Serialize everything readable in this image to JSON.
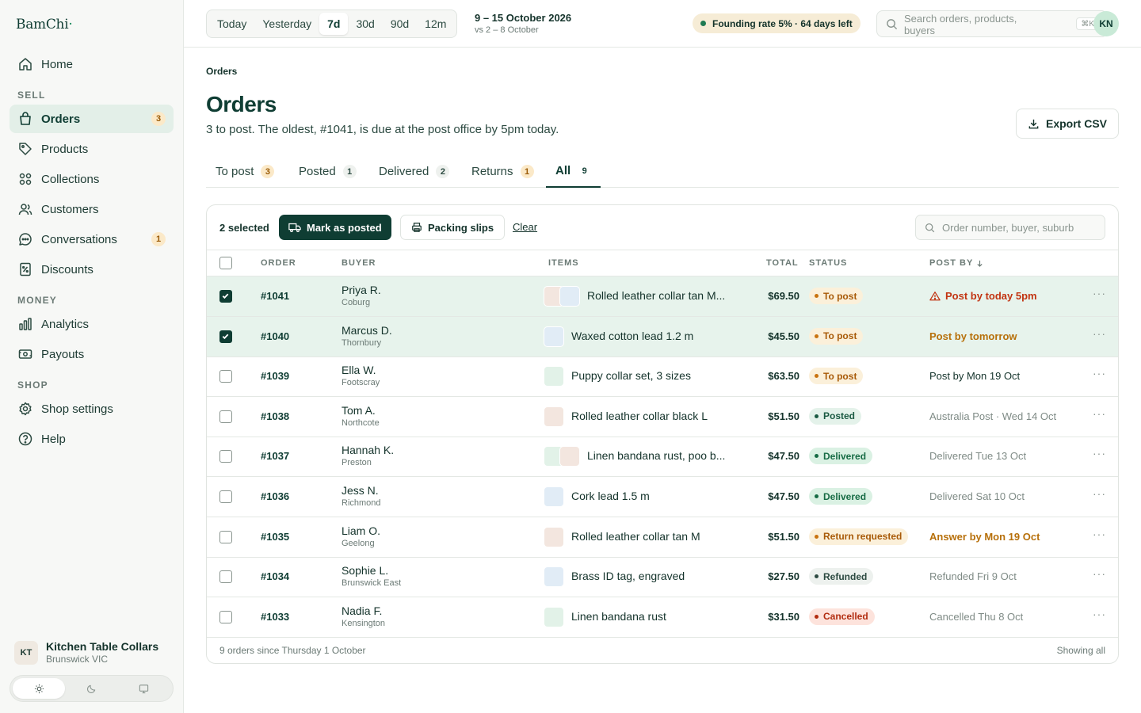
{
  "app": {
    "logo": "BamChi",
    "logo_mark": "·"
  },
  "sidebar": {
    "sections": {
      "sell": "SELL",
      "money": "MONEY",
      "shop": "SHOP"
    },
    "items": [
      {
        "label": "Home",
        "icon": "home-icon"
      },
      {
        "label": "Orders",
        "icon": "bag-icon",
        "count": "3",
        "active": true
      },
      {
        "label": "Products",
        "icon": "tag-icon"
      },
      {
        "label": "Collections",
        "icon": "grid-icon"
      },
      {
        "label": "Customers",
        "icon": "users-icon"
      },
      {
        "label": "Conversations",
        "icon": "chat-icon",
        "count": "1"
      },
      {
        "label": "Discounts",
        "icon": "discount-icon"
      },
      {
        "label": "Analytics",
        "icon": "bar-chart-icon"
      },
      {
        "label": "Payouts",
        "icon": "payout-icon"
      },
      {
        "label": "Shop settings",
        "icon": "gear-icon"
      },
      {
        "label": "Help",
        "icon": "help-icon"
      }
    ],
    "shop": {
      "initials": "KT",
      "name": "Kitchen Table Collars",
      "location": "Brunswick VIC"
    },
    "theme": {
      "options": [
        "light",
        "dark",
        "system"
      ],
      "selected": "light"
    }
  },
  "topbar": {
    "ranges": [
      "Today",
      "Yesterday",
      "7d",
      "30d",
      "90d",
      "12m"
    ],
    "selected_range": "7d",
    "date_main": "9 – 15 October 2026",
    "date_compare": "vs 2 – 8 October",
    "rate_pill": "Founding rate 5% · 64 days left",
    "search_placeholder": "Search orders, products, buyers",
    "search_shortcut": "⌘K",
    "user_initials": "KN"
  },
  "page": {
    "breadcrumb": "Orders",
    "title": "Orders",
    "subtitle": "3 to post. The oldest, #1041, is due at the post office by 5pm today.",
    "export_label": "Export CSV"
  },
  "tabs": [
    {
      "label": "To post",
      "count": "3"
    },
    {
      "label": "Posted",
      "count": "1"
    },
    {
      "label": "Delivered",
      "count": "2"
    },
    {
      "label": "Returns",
      "count": "1"
    },
    {
      "label": "All",
      "count": "9",
      "active": true
    }
  ],
  "bulk": {
    "selected_label": "2 selected",
    "mark_posted": "Mark as posted",
    "packing_slips": "Packing slips",
    "clear": "Clear",
    "search_placeholder": "Order number, buyer, suburb"
  },
  "table": {
    "columns": {
      "order": "ORDER",
      "buyer": "BUYER",
      "items": "ITEMS",
      "total": "TOTAL",
      "status": "STATUS",
      "post_by": "POST BY"
    },
    "rows": [
      {
        "selected": true,
        "order": "#1041",
        "buyer": "Priya R.",
        "suburb": "Coburg",
        "item": "Rolled leather collar tan M...",
        "thumbs": [
          "#f3e6df",
          "#e1ecf6"
        ],
        "total": "$69.50",
        "status": "To post",
        "status_kind": "topost",
        "post_by": "Post by today 5pm",
        "post_kind": "urgent"
      },
      {
        "selected": true,
        "order": "#1040",
        "buyer": "Marcus D.",
        "suburb": "Thornbury",
        "item": "Waxed cotton lead 1.2 m",
        "thumbs": [
          "#e1ecf6"
        ],
        "total": "$45.50",
        "status": "To post",
        "status_kind": "topost",
        "post_by": "Post by tomorrow",
        "post_kind": "warn"
      },
      {
        "selected": false,
        "order": "#1039",
        "buyer": "Ella W.",
        "suburb": "Footscray",
        "item": "Puppy collar set, 3 sizes",
        "thumbs": [
          "#e2f2e8"
        ],
        "total": "$63.50",
        "status": "To post",
        "status_kind": "topost",
        "post_by": "Post by Mon 19 Oct",
        "post_kind": "normal"
      },
      {
        "selected": false,
        "order": "#1038",
        "buyer": "Tom A.",
        "suburb": "Northcote",
        "item": "Rolled leather collar black L",
        "thumbs": [
          "#f3e6df"
        ],
        "total": "$51.50",
        "status": "Posted",
        "status_kind": "posted",
        "post_by": "Australia Post · Wed 14 Oct",
        "post_kind": "muted"
      },
      {
        "selected": false,
        "order": "#1037",
        "buyer": "Hannah K.",
        "suburb": "Preston",
        "item": "Linen bandana rust, poo b...",
        "thumbs": [
          "#e2f2e8",
          "#f3e6df"
        ],
        "total": "$47.50",
        "status": "Delivered",
        "status_kind": "delivered",
        "post_by": "Delivered Tue 13 Oct",
        "post_kind": "muted"
      },
      {
        "selected": false,
        "order": "#1036",
        "buyer": "Jess N.",
        "suburb": "Richmond",
        "item": "Cork lead 1.5 m",
        "thumbs": [
          "#e1ecf6"
        ],
        "total": "$47.50",
        "status": "Delivered",
        "status_kind": "delivered",
        "post_by": "Delivered Sat 10 Oct",
        "post_kind": "muted"
      },
      {
        "selected": false,
        "order": "#1035",
        "buyer": "Liam O.",
        "suburb": "Geelong",
        "item": "Rolled leather collar tan M",
        "thumbs": [
          "#f3e6df"
        ],
        "total": "$51.50",
        "status": "Return requested",
        "status_kind": "return",
        "post_by": "Answer by Mon 19 Oct",
        "post_kind": "warn"
      },
      {
        "selected": false,
        "order": "#1034",
        "buyer": "Sophie L.",
        "suburb": "Brunswick East",
        "item": "Brass ID tag, engraved",
        "thumbs": [
          "#e1ecf6"
        ],
        "total": "$27.50",
        "status": "Refunded",
        "status_kind": "refunded",
        "post_by": "Refunded Fri 9 Oct",
        "post_kind": "muted"
      },
      {
        "selected": false,
        "order": "#1033",
        "buyer": "Nadia F.",
        "suburb": "Kensington",
        "item": "Linen bandana rust",
        "thumbs": [
          "#e2f2e8"
        ],
        "total": "$31.50",
        "status": "Cancelled",
        "status_kind": "cancelled",
        "post_by": "Cancelled Thu 8 Oct",
        "post_kind": "muted"
      }
    ],
    "footer_left": "9 orders since Thursday 1 October",
    "footer_right": "Showing all"
  },
  "colors": {
    "brand": "#0f3d33",
    "accent_bg": "#e3efe8",
    "urgent": "#c23412",
    "warning": "#b7700b"
  }
}
